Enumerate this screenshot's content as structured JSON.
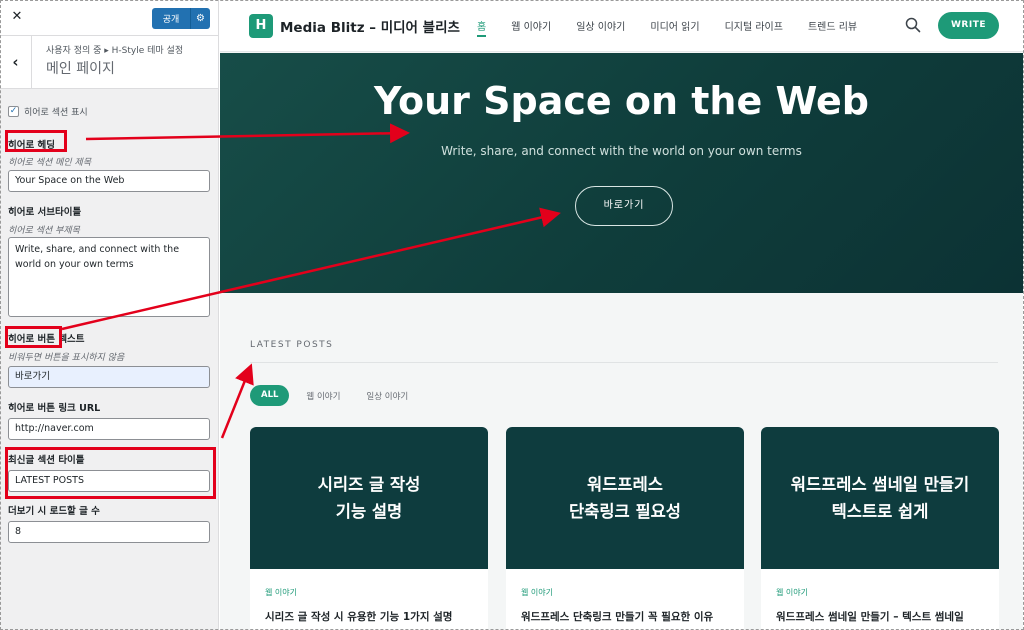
{
  "customizer": {
    "close_label": "✕",
    "publish_label": "공개",
    "breadcrumb": "사용자 정의 중 ▸ H-Style 테마 설정",
    "section_title": "메인 페이지",
    "show_hero_label": "히어로 섹션 표시",
    "hero_heading": {
      "title": "히어로 헤딩",
      "desc": "히어로 섹션 메인 제목",
      "value": "Your Space on the Web"
    },
    "hero_subtitle": {
      "title": "히어로 서브타이틀",
      "desc": "히어로 섹션 부제목",
      "value": "Write, share, and connect with the world on your own terms"
    },
    "hero_button_text": {
      "title": "히어로 버튼 텍스트",
      "desc": "비워두면 버튼을 표시하지 않음",
      "value": "바로가기"
    },
    "hero_button_link": {
      "title": "히어로 버튼 링크 URL",
      "value": "http://naver.com"
    },
    "latest_title": {
      "title": "최신글 섹션 타이틀",
      "value": "LATEST POSTS"
    },
    "load_more_count": {
      "title": "더보기 시 로드할 글 수",
      "value": "8"
    }
  },
  "site": {
    "logo_letter": "H",
    "name": "Media Blitz – 미디어 블리츠",
    "nav": [
      {
        "label": "홈",
        "active": true
      },
      {
        "label": "웹 이야기"
      },
      {
        "label": "일상 이야기"
      },
      {
        "label": "미디어 읽기"
      },
      {
        "label": "디지털 라이프"
      },
      {
        "label": "트렌드 리뷰"
      }
    ],
    "write_label": "WRITE",
    "hero": {
      "title": "Your Space on the Web",
      "subtitle": "Write, share, and connect with the world on your own terms",
      "button": "바로가기"
    },
    "latest_label": "LATEST POSTS",
    "filters": [
      "ALL",
      "웹 이야기",
      "일상 이야기"
    ],
    "cards": [
      {
        "thumb_line1": "시리즈 글 작성",
        "thumb_line2": "기능 설명",
        "category": "웹 이야기",
        "title": "시리즈 글 작성 시 유용한 기능 1가지 설명"
      },
      {
        "thumb_line1": "워드프레스",
        "thumb_line2": "단축링크 필요성",
        "category": "웹 이야기",
        "title": "워드프레스 단축링크 만들기 꼭 필요한 이유"
      },
      {
        "thumb_line1": "워드프레스 썸네일 만들기",
        "thumb_line2": "텍스트로 쉽게",
        "category": "웹 이야기",
        "title": "워드프레스 썸네일 만들기 – 텍스트 썸네일"
      }
    ]
  },
  "colors": {
    "accent": "#1e9a78",
    "hero_bg": "#0f3d3b",
    "annotation": "#e3001b",
    "wp_blue": "#2271b1"
  }
}
